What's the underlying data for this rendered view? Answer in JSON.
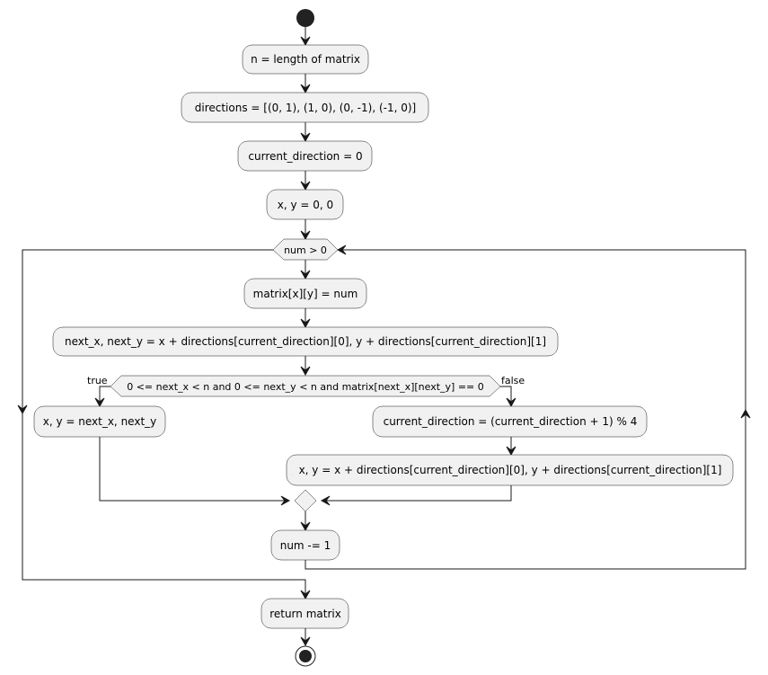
{
  "diagram": {
    "type": "activity",
    "actions": {
      "n_len": "n = length of matrix",
      "directions": "directions = [(0, 1), (1, 0), (0, -1), (-1, 0)]",
      "cur_dir": "current_direction = 0",
      "xy_init": "x, y = 0, 0",
      "set_cell": "matrix[x][y] = num",
      "next_xy": "next_x, next_y = x + directions[current_direction][0], y + directions[current_direction][1]",
      "move": "x, y = next_x, next_y",
      "turn": "current_direction = (current_direction + 1) % 4",
      "move_turned": "x, y = x + directions[current_direction][0], y + directions[current_direction][1]",
      "decrement": "num -= 1",
      "ret": "return matrix"
    },
    "decisions": {
      "loop": "num > 0",
      "check": "0 <= next_x < n and 0 <= next_y < n and matrix[next_x][next_y] == 0"
    },
    "branch_labels": {
      "true": "true",
      "false": "false"
    }
  }
}
